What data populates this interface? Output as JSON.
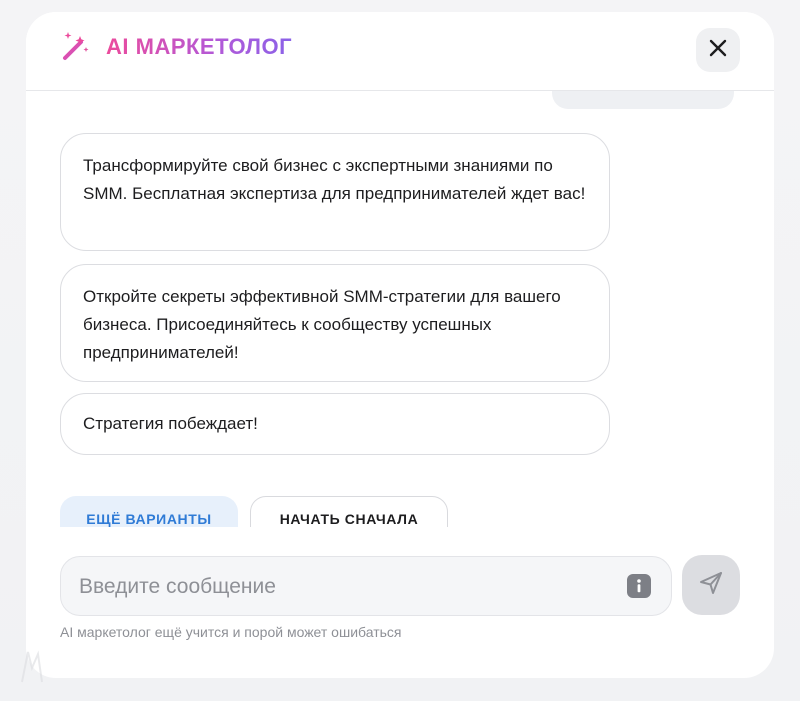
{
  "header": {
    "logo_text": "AI МАРКЕТОЛОГ",
    "logo_icon": "magic-wand-sparkles-icon",
    "close_icon": "close-icon"
  },
  "chat": {
    "partial_user_message": "...",
    "messages": [
      "Трансформируйте свой бизнес с экспертными знаниями по SMM. Бесплатная экспертиза для предпринимателей ждет вас!",
      "Откройте секреты эффективной SMM-стратегии для вашего бизнеса. Присоединяйтесь к сообществу успешных предпринимателей!",
      "Стратегия побеждает!"
    ],
    "actions": {
      "more_label": "ЕЩЁ ВАРИАНТЫ",
      "restart_label": "НАЧАТЬ СНАЧАЛА"
    }
  },
  "composer": {
    "placeholder": "Введите сообщение",
    "value": "",
    "info_icon": "info-icon",
    "send_icon": "send-icon"
  },
  "footer": {
    "disclaimer": "AI маркетолог ещё учится и порой может ошибаться"
  },
  "colors": {
    "brand_gradient_start": "#ec4b9c",
    "brand_gradient_end": "#8a62e8",
    "accent_blue": "#2f7bd6",
    "chip_blue_bg": "#e7f0fb"
  }
}
